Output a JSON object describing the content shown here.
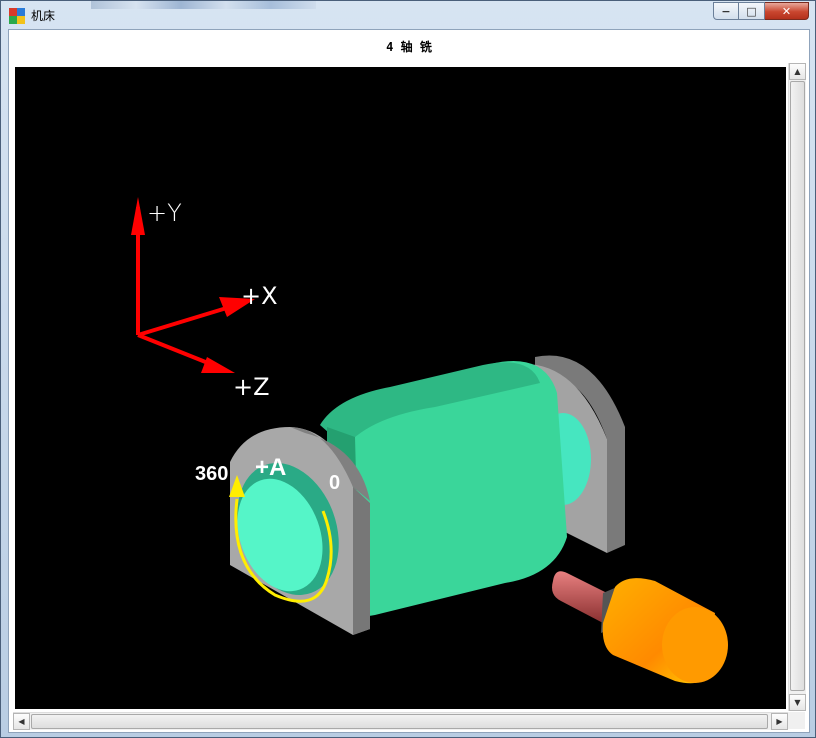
{
  "window": {
    "title": "机床",
    "controls": {
      "minimize": "−",
      "maximize": "□",
      "close": "✕"
    }
  },
  "document": {
    "title": "4 轴 铣"
  },
  "scene": {
    "axes": {
      "y_label": "+Y",
      "x_label": "+X",
      "z_label": "+Z",
      "color": "#ff0000"
    },
    "rotary_axis": {
      "label": "+A",
      "start_value": "0",
      "end_value": "360",
      "arrow_color": "#ffee00"
    },
    "colors": {
      "background": "#000000",
      "table": "#3ad69a",
      "support": "#a0a0a0",
      "tool_holder": "#ff9a00",
      "tool": "#c05050"
    }
  },
  "scrollbars": {
    "up_arrow": "▲",
    "down_arrow": "▼",
    "left_arrow": "◀",
    "right_arrow": "▶"
  }
}
